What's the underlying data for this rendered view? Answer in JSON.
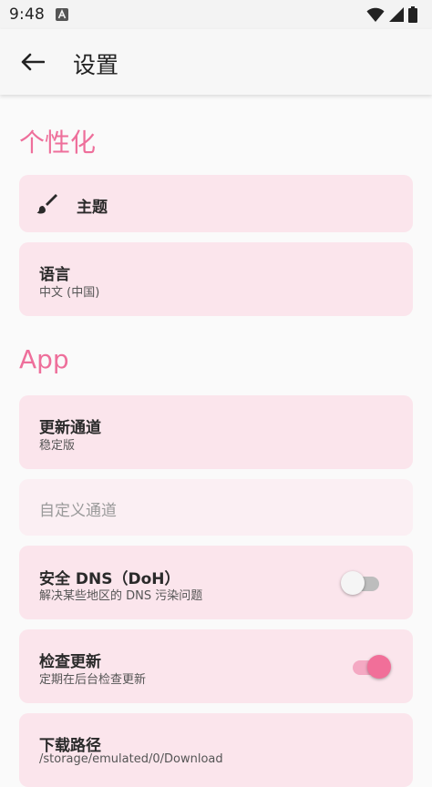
{
  "status_bar": {
    "time": "9:48",
    "icons": [
      "a-icon",
      "wifi-icon",
      "signal-icon",
      "battery-icon"
    ]
  },
  "app_bar": {
    "title": "设置"
  },
  "sections": {
    "personalization": {
      "title": "个性化"
    },
    "app": {
      "title": "App"
    }
  },
  "items": {
    "theme": {
      "label": "主题",
      "icon": "brush-icon"
    },
    "language": {
      "label": "语言",
      "value": "中文 (中国)"
    },
    "update_channel": {
      "label": "更新通道",
      "value": "稳定版"
    },
    "custom_channel": {
      "label": "自定义通道"
    },
    "secure_dns": {
      "label": "安全 DNS（DoH）",
      "desc": "解决某些地区的 DNS 污染问题",
      "enabled": false
    },
    "check_updates": {
      "label": "检查更新",
      "desc": "定期在后台检查更新",
      "enabled": true
    },
    "download_path": {
      "label": "下载路径",
      "value": "/storage/emulated/0/Download"
    }
  },
  "colors": {
    "accent": "#ee6f9b",
    "card_bg": "#fbe5ec",
    "switch_on": "#f16f99"
  }
}
